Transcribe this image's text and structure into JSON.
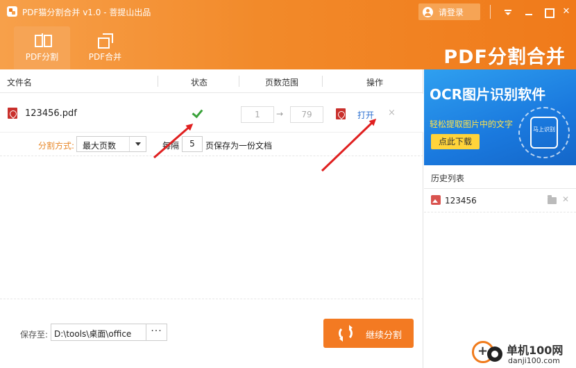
{
  "window": {
    "title": "PDF猫分割合并 v1.0 - 菩提山出品",
    "login_label": "请登录"
  },
  "tabs": [
    {
      "label": "PDF分割",
      "active": true
    },
    {
      "label": "PDF合并",
      "active": false
    }
  ],
  "banner": {
    "title": "PDF分割合并"
  },
  "table": {
    "headers": [
      "文件名",
      "状态",
      "页数范围",
      "操作"
    ],
    "rows": [
      {
        "file_name": "123456.pdf",
        "status": "done",
        "range_start": "1",
        "range_arrow": "→",
        "range_end": "79",
        "action_label": "打开",
        "remove_label": "×"
      }
    ]
  },
  "options": {
    "mode_label": "分割方式:",
    "mode_value": "最大页数",
    "every_label": "每隔",
    "page_count": "5",
    "save_per_label": "页保存为一份文档"
  },
  "footer": {
    "save_to_label": "保存至:",
    "save_path": "D:\\tools\\桌面\\office",
    "browse_label": "···",
    "continue_label": "继续分割"
  },
  "ad": {
    "title": "OCR图片识别软件",
    "subtitle": "轻松提取图片中的文字",
    "button_label": "点此下载",
    "badge_text": "马上识别"
  },
  "history": {
    "title": "历史列表",
    "items": [
      {
        "name": "123456"
      }
    ]
  },
  "watermark": {
    "name": "单机100网",
    "url": "danji100.com"
  },
  "colors": {
    "header_orange": "#f28a2a",
    "accent_orange": "#f37a22",
    "link_blue": "#2b6fd1",
    "check_green": "#3aa23a",
    "annotation_red": "#e02020"
  }
}
